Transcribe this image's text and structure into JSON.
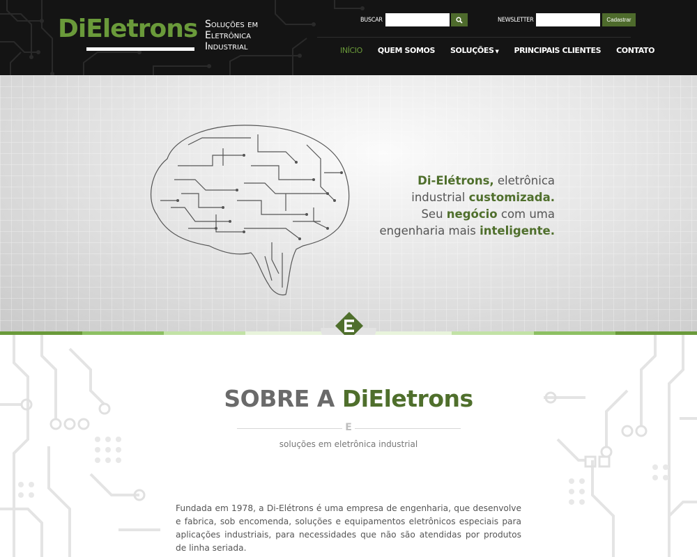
{
  "header": {
    "logo": {
      "prefix": "Di",
      "middle": "E",
      "suffix": "letrons"
    },
    "tagline": [
      "Soluções em",
      "Eletrônica",
      "Industrial"
    ],
    "search": {
      "label": "BUSCAR",
      "placeholder": ""
    },
    "newsletter": {
      "label": "NEWSLETTER",
      "placeholder": "",
      "button": "Cadastrar"
    },
    "nav": [
      {
        "label": "INÍCIO",
        "active": true
      },
      {
        "label": "QUEM SOMOS"
      },
      {
        "label": "SOLUÇÕES",
        "dropdown": true
      },
      {
        "label": "PRINCIPAIS CLIENTES"
      },
      {
        "label": "CONTATO"
      }
    ]
  },
  "hero": {
    "lines": [
      [
        {
          "t": "Di-Elétrons,",
          "b": true
        },
        {
          "t": " eletrônica"
        }
      ],
      [
        {
          "t": "industrial "
        },
        {
          "t": "customizada.",
          "b": true
        }
      ],
      [
        {
          "t": "Seu "
        },
        {
          "t": "negócio",
          "b": true
        },
        {
          "t": " com uma"
        }
      ],
      [
        {
          "t": "engenharia mais "
        },
        {
          "t": "inteligente.",
          "b": true
        }
      ]
    ]
  },
  "about": {
    "title_prefix": "SOBRE A ",
    "brand_di": "Di",
    "brand_e": "E",
    "brand_rest": "letrons",
    "rule_mark": "E",
    "subtitle": "soluções em eletrônica industrial",
    "body": "Fundada em 1978, a Di-Elétrons é uma empresa de engenharia, que desenvolve e fabrica, sob encomenda, soluções e equipamentos eletrônicos especiais para aplicações industriais, para necessidades que não são atendidas por produtos de linha seriada."
  },
  "colors": {
    "brand_green": "#4f6f2c",
    "logo_green": "#6a9a3a",
    "header_bg": "#141414",
    "stripe": [
      "#6a9a3a",
      "#8dc063",
      "#c2e2a6",
      "#e8f4dc",
      "#c2e2a6",
      "#8dc063",
      "#6a9a3a"
    ]
  }
}
